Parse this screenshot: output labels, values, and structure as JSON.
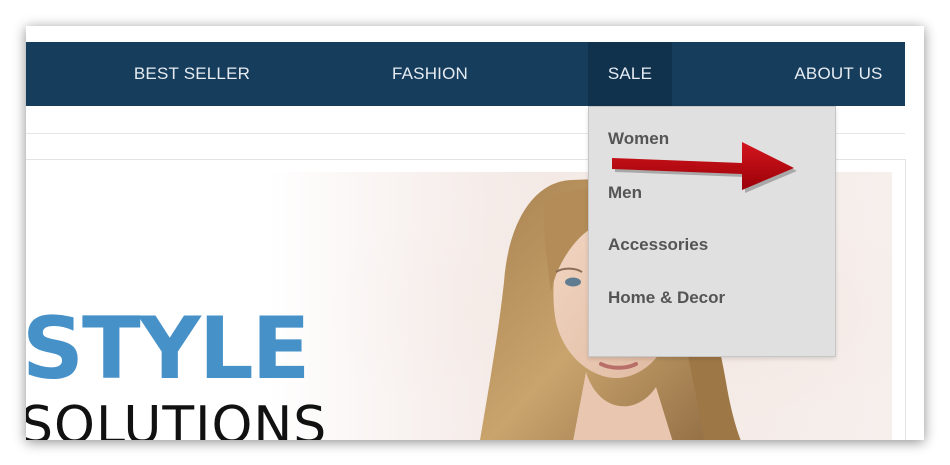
{
  "nav": {
    "items": [
      {
        "label": "BEST SELLER"
      },
      {
        "label": "FASHION"
      },
      {
        "label": "SALE"
      },
      {
        "label": "ABOUT US"
      }
    ],
    "active": "SALE"
  },
  "dropdown": {
    "items": [
      {
        "label": "Women"
      },
      {
        "label": "Men"
      },
      {
        "label": "Accessories"
      },
      {
        "label": "Home & Decor"
      }
    ]
  },
  "hero": {
    "line1": "STYLE",
    "line2": "SOLUTIONS"
  },
  "colors": {
    "nav_background": "#163d5c",
    "nav_active_background": "#10324d",
    "dropdown_background": "#e0e0e0",
    "hero_accent": "#4791c9",
    "annotation_arrow": "#b5000b"
  },
  "annotation": {
    "icon": "red-arrow-icon"
  }
}
